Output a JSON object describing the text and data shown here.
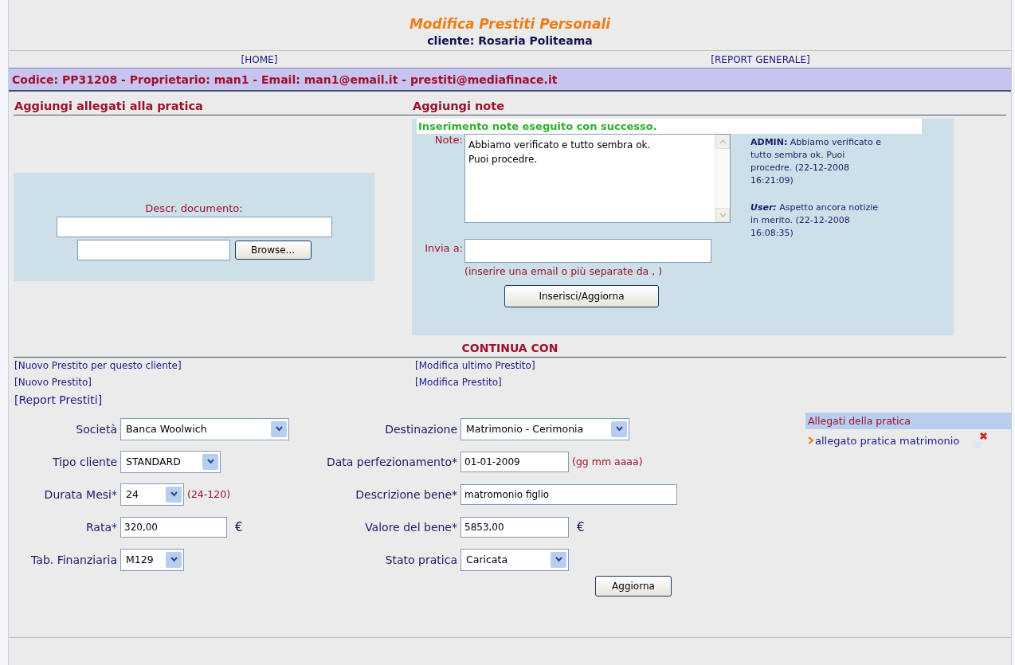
{
  "header": {
    "title": "Modifica Prestiti Personali",
    "client": "cliente: Rosaria Politeama"
  },
  "nav": [
    "[HOME]",
    "[REPORT GENERALE]"
  ],
  "info_bar": "Codice: PP31208 - Proprietario: man1 - Email: man1@email.it - prestiti@mediafinace.it",
  "attachments_section": {
    "heading": "Aggiungi allegati alla pratica",
    "descr_label": "Descr. documento:",
    "browse_button": "Browse..."
  },
  "notes_section": {
    "heading": "Aggiungi note",
    "success": "Inserimento note eseguito con successo.",
    "note_label": "Note:",
    "note_value": "Abbiamo verificato e tutto sembra ok.\nPuoi procedre.",
    "send_label": "Invia a:",
    "send_hint": "(inserire una email o più separate da , )",
    "submit_button": "Inserisci/Aggiorna",
    "history": [
      {
        "author": "ADMIN:",
        "italic": false,
        "text": "Abbiamo verificato e tutto sembra ok. Puoi procedre. (22-12-2008 16:21:09)"
      },
      {
        "author": "User:",
        "italic": true,
        "text": "Aspetto ancora notizie in merito. (22-12-2008 16:08:35)"
      }
    ]
  },
  "continue_heading": "CONTINUA CON",
  "links": [
    "[Nuovo Prestito per questo cliente]",
    "[Modifica ultimo Prestito]",
    "[Nuovo Prestito]",
    "[Modifica Prestito]",
    "[Report Prestiti]"
  ],
  "form_left": [
    {
      "label": "Società",
      "kind": "select",
      "value": "Banca Woolwich"
    },
    {
      "label": "Tipo cliente",
      "kind": "select",
      "value": "STANDARD"
    },
    {
      "label": "Durata Mesi*",
      "kind": "select",
      "value": "24",
      "hint": "(24-120)"
    },
    {
      "label": "Rata*",
      "kind": "input",
      "value": "320,00",
      "suffix": "€"
    },
    {
      "label": "Tab. Finanziaria",
      "kind": "select",
      "value": "M129"
    }
  ],
  "form_right": [
    {
      "label": "Destinazione",
      "kind": "select",
      "value": "Matrimonio - Cerimonia"
    },
    {
      "label": "Data perfezionamento*",
      "kind": "input",
      "value": "01-01-2009",
      "hint": "(gg mm aaaa)"
    },
    {
      "label": "Descrizione bene*",
      "kind": "input",
      "value": "matromonio figlio"
    },
    {
      "label": "Valore del bene*",
      "kind": "input",
      "value": "5853,00",
      "suffix": "€"
    },
    {
      "label": "Stato pratica",
      "kind": "select",
      "value": "Caricata"
    }
  ],
  "update_button": "Aggiorna",
  "attachments_list": {
    "heading": "Allegati della pratica",
    "items": [
      "allegato pratica matrimonio"
    ]
  }
}
